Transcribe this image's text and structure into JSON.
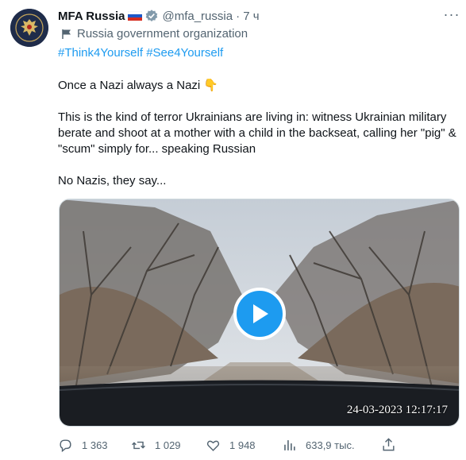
{
  "author": {
    "name": "MFA Russia",
    "handle": "@mfa_russia",
    "time": "· 7 ч",
    "affiliation": "Russia government organization"
  },
  "tweet": {
    "hashtags": [
      "#Think4Yourself",
      "#See4Yourself"
    ],
    "line1": "Once a Nazi always a Nazi 👇",
    "line2": "This is the kind of terror Ukrainians are living in: witness Ukrainian military berate and shoot at a mother with a child in the backseat, calling her \"pig\" & \"scum\" simply for... speaking Russian",
    "line3": "No Nazis, they say..."
  },
  "media": {
    "timestamp": "24-03-2023 12:17:17"
  },
  "actions": {
    "replies": "1 363",
    "retweets": "1 029",
    "likes": "1 948",
    "views": "633,9 тыс."
  },
  "colors": {
    "accent": "#1d9bf0",
    "text": "#0f1419",
    "muted": "#536471"
  },
  "icons": [
    "verified-badge-icon",
    "russia-flag-icon",
    "affiliation-flag-icon",
    "reply-icon",
    "retweet-icon",
    "like-icon",
    "views-icon",
    "share-icon",
    "play-icon",
    "more-icon"
  ]
}
